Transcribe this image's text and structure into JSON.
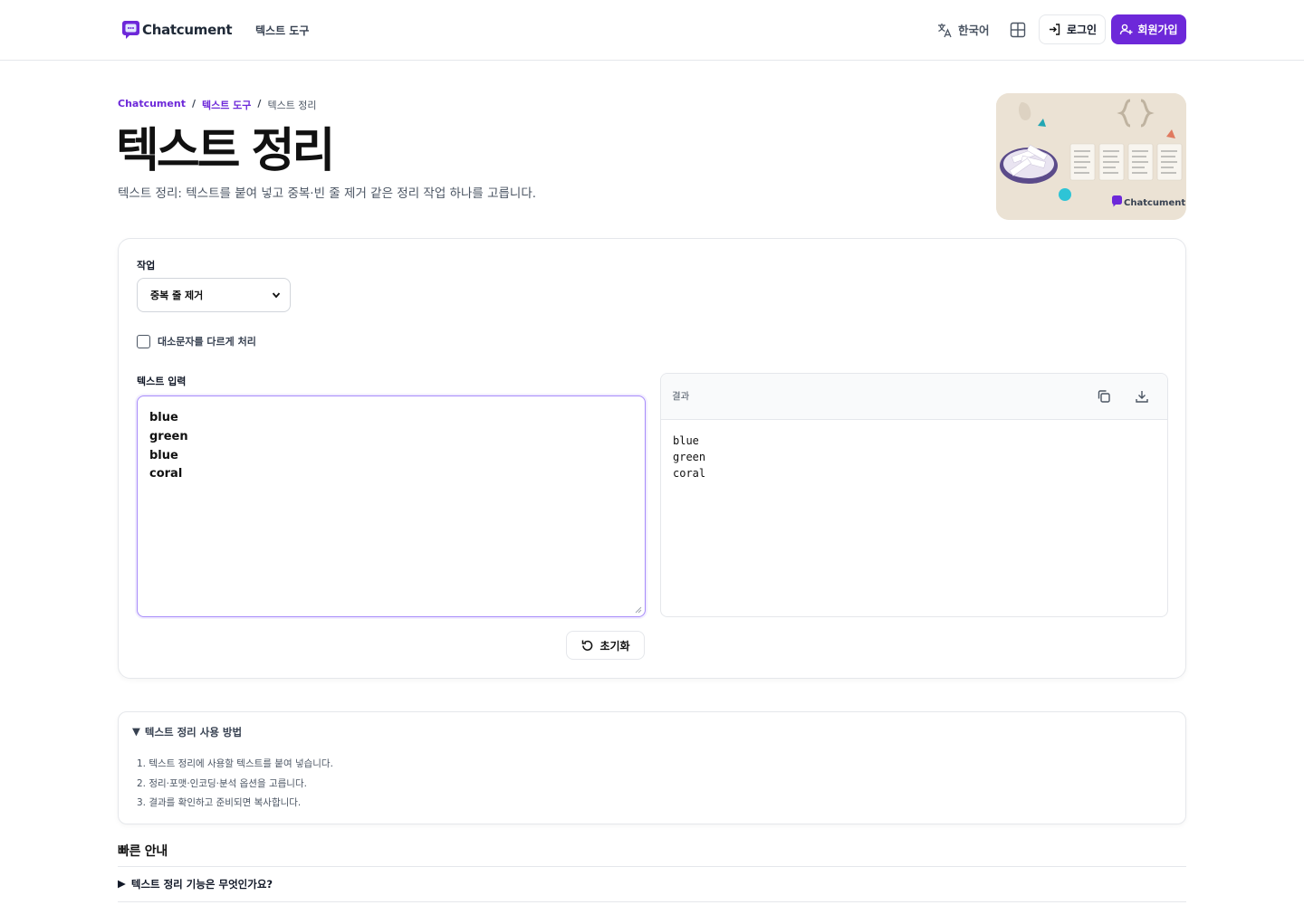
{
  "header": {
    "brand": "Chatcument",
    "nav_link": "텍스트 도구",
    "language": "한국어",
    "login": "로그인",
    "signup": "회원가입",
    "accent_color": "#6d28d9"
  },
  "breadcrumb": {
    "home": "Chatcument",
    "sep": "/",
    "section": "텍스트 도구",
    "current": "텍스트 정리"
  },
  "hero": {
    "title": "텍스트 정리",
    "description": "텍스트 정리: 텍스트를 붙여 넣고 중복·빈 줄 제거 같은 정리 작업 하나를 고릅니다.",
    "image_brand": "Chatcument"
  },
  "tool": {
    "operation_label": "작업",
    "operation_selected": "중복 줄 제거",
    "case_sensitive_label": "대소문자를 다르게 처리",
    "case_sensitive_checked": false,
    "input_label": "텍스트 입력",
    "input_lines": [
      "blue",
      "green",
      "blue",
      "coral"
    ],
    "result_label": "결과",
    "result_lines": [
      "blue",
      "green",
      "coral"
    ],
    "reset_label": "초기화"
  },
  "howto": {
    "title": "텍스트 정리 사용 방법",
    "steps": [
      "1. 텍스트 정리에 사용할 텍스트를 붙여 넣습니다.",
      "2. 정리·포맷·인코딩·분석 옵션을 고릅니다.",
      "3. 결과를 확인하고 준비되면 복사합니다."
    ]
  },
  "quick_guide": {
    "title": "빠른 안내",
    "faq": [
      "텍스트 정리 기능은 무엇인가요?"
    ]
  }
}
